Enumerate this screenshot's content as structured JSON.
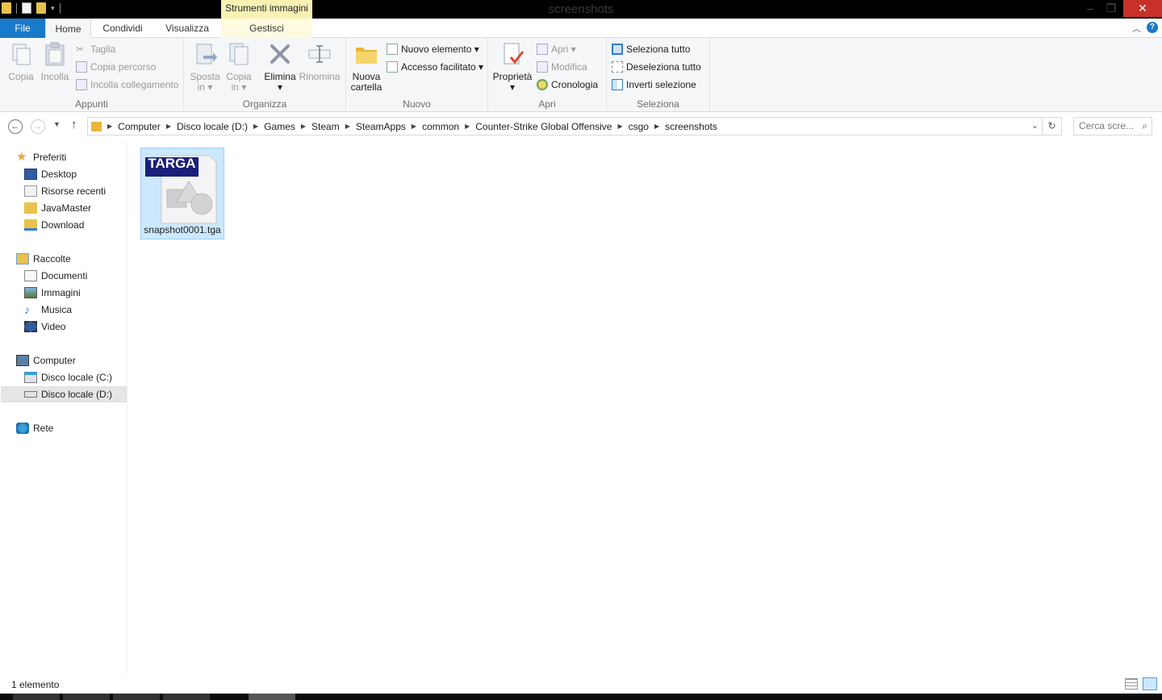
{
  "window": {
    "title": "screenshots",
    "minimize": "–",
    "maximize": "❐",
    "close": "✕"
  },
  "tabs": {
    "file": "File",
    "home": "Home",
    "condividi": "Condividi",
    "visualizza": "Visualizza",
    "context_title": "Strumenti immagini",
    "gestisci": "Gestisci"
  },
  "ribbon": {
    "appunti": {
      "label": "Appunti",
      "copia": "Copia",
      "incolla": "Incolla",
      "taglia": "Taglia",
      "copia_percorso": "Copia percorso",
      "incolla_collegamento": "Incolla collegamento"
    },
    "organizza": {
      "label": "Organizza",
      "sposta": "Sposta",
      "sposta_sub": "in ▾",
      "copia": "Copia",
      "copia_sub": "in ▾",
      "elimina": "Elimina",
      "elimina_sub": "▾",
      "rinomina": "Rinomina"
    },
    "nuovo": {
      "label": "Nuovo",
      "nuova_cartella_1": "Nuova",
      "nuova_cartella_2": "cartella",
      "nuovo_elemento": "Nuovo elemento ▾",
      "accesso_facilitato": "Accesso facilitato ▾"
    },
    "apri": {
      "label": "Apri",
      "proprieta": "Proprietà",
      "proprieta_sub": "▾",
      "apri": "Apri ▾",
      "modifica": "Modifica",
      "cronologia": "Cronologia"
    },
    "seleziona": {
      "label": "Seleziona",
      "seleziona_tutto": "Seleziona tutto",
      "deseleziona_tutto": "Deseleziona tutto",
      "inverti_selezione": "Inverti selezione"
    }
  },
  "address": {
    "crumbs": [
      "Computer",
      "Disco locale (D:)",
      "Games",
      "Steam",
      "SteamApps",
      "common",
      "Counter-Strike Global Offensive",
      "csgo",
      "screenshots"
    ],
    "search_placeholder": "Cerca scre..."
  },
  "nav": {
    "preferiti": "Preferiti",
    "preferiti_items": [
      "Desktop",
      "Risorse recenti",
      "JavaMaster",
      "Download"
    ],
    "raccolte": "Raccolte",
    "raccolte_items": [
      "Documenti",
      "Immagini",
      "Musica",
      "Video"
    ],
    "computer": "Computer",
    "computer_items": [
      "Disco locale (C:)",
      "Disco locale (D:)"
    ],
    "rete": "Rete"
  },
  "content": {
    "file_name": "snapshot0001.tga",
    "file_badge": "TARGA"
  },
  "status": {
    "count": "1 elemento"
  },
  "colors": {
    "accent": "#1979ca",
    "selection": "#cce8ff",
    "context": "#f7f1b4"
  }
}
